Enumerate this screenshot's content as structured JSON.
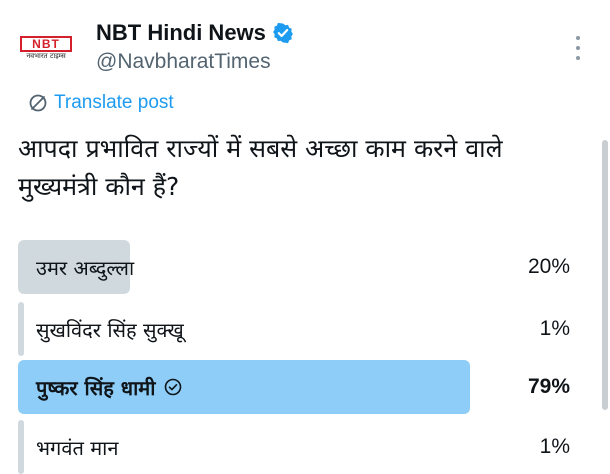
{
  "post": {
    "author": {
      "name": "NBT Hindi News",
      "handle": "@NavbharatTimes",
      "logo_text": "NBT",
      "logo_subtext": "नवभारत टाइम्स",
      "verified_color": "#1d9bf0"
    },
    "translate_label": "Translate post",
    "text": "आपदा प्रभावित राज्यों में सबसे अच्छा काम करने वाले मुख्यमंत्री कौन हैं?",
    "poll": {
      "options": [
        {
          "label": "उमर अब्दुल्ला",
          "percent_text": "20%",
          "percent": 20,
          "winner": false
        },
        {
          "label": "सुखविंदर सिंह सुक्खू",
          "percent_text": "1%",
          "percent": 1,
          "winner": false
        },
        {
          "label": "पुष्कर सिंह धामी",
          "percent_text": "79%",
          "percent": 79,
          "winner": true
        },
        {
          "label": "भगवंत मान",
          "percent_text": "1%",
          "percent": 1,
          "winner": false
        }
      ]
    },
    "colors": {
      "accent": "#1d9bf0",
      "bar_default": "#cfd9de",
      "bar_winner": "#8ecdf8"
    }
  }
}
